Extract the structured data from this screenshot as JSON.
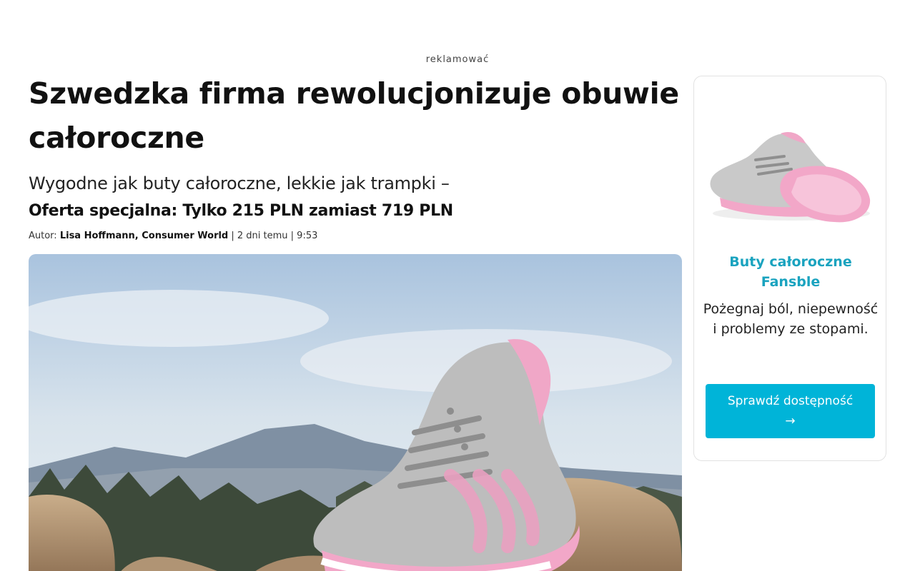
{
  "ad_label": "reklamować",
  "article": {
    "title": "Szwedzka firma rewolucjonizuje obuwie całoroczne",
    "subtitle": "Wygodne jak buty całoroczne, lekkie jak trampki –",
    "offer": "Oferta specjalna: Tylko 215 PLN zamiast 719 PLN",
    "byline": {
      "prefix": "Autor:",
      "author": "Lisa Hoffmann, Consumer World",
      "meta": "| 2 dni temu | 9:53"
    }
  },
  "sidebar": {
    "product_title": "Buty całoroczne Fansble",
    "product_text": "Pożegnaj ból, niepewność i problemy ze stopami.",
    "cta_label": "Sprawdź dostępność",
    "cta_arrow": "→"
  },
  "colors": {
    "accent": "#1aa3bf",
    "cta_background": "#00b4d8",
    "shoe_pink": "#f2a7c8",
    "shoe_grey": "#b9b9b9"
  }
}
